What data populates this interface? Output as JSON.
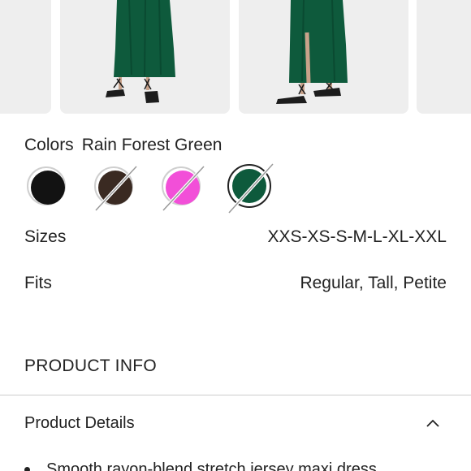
{
  "gallery": {
    "images": [
      {
        "name": "product-photo-1"
      },
      {
        "name": "product-photo-2"
      },
      {
        "name": "product-photo-3"
      },
      {
        "name": "product-photo-4"
      }
    ],
    "dress_color": "#0e5a3c",
    "background_color": "#eeeeee"
  },
  "colors": {
    "label": "Colors",
    "selected_name": "Rain Forest Green",
    "swatches": [
      {
        "color": "#121212",
        "unavailable": false
      },
      {
        "color": "#3a2a22",
        "unavailable": true
      },
      {
        "color": "#f24fd8",
        "unavailable": true
      },
      {
        "color": "#0e5a3c",
        "unavailable": true,
        "selected": true
      }
    ]
  },
  "sizes": {
    "label": "Sizes",
    "value": "XXS-XS-S-M-L-XL-XXL"
  },
  "fits": {
    "label": "Fits",
    "value": "Regular, Tall, Petite"
  },
  "product_info": {
    "title": "PRODUCT INFO",
    "details_header": "Product Details",
    "details_expanded": true,
    "bullets": [
      "Smooth rayon-blend stretch jersey maxi dress"
    ]
  }
}
